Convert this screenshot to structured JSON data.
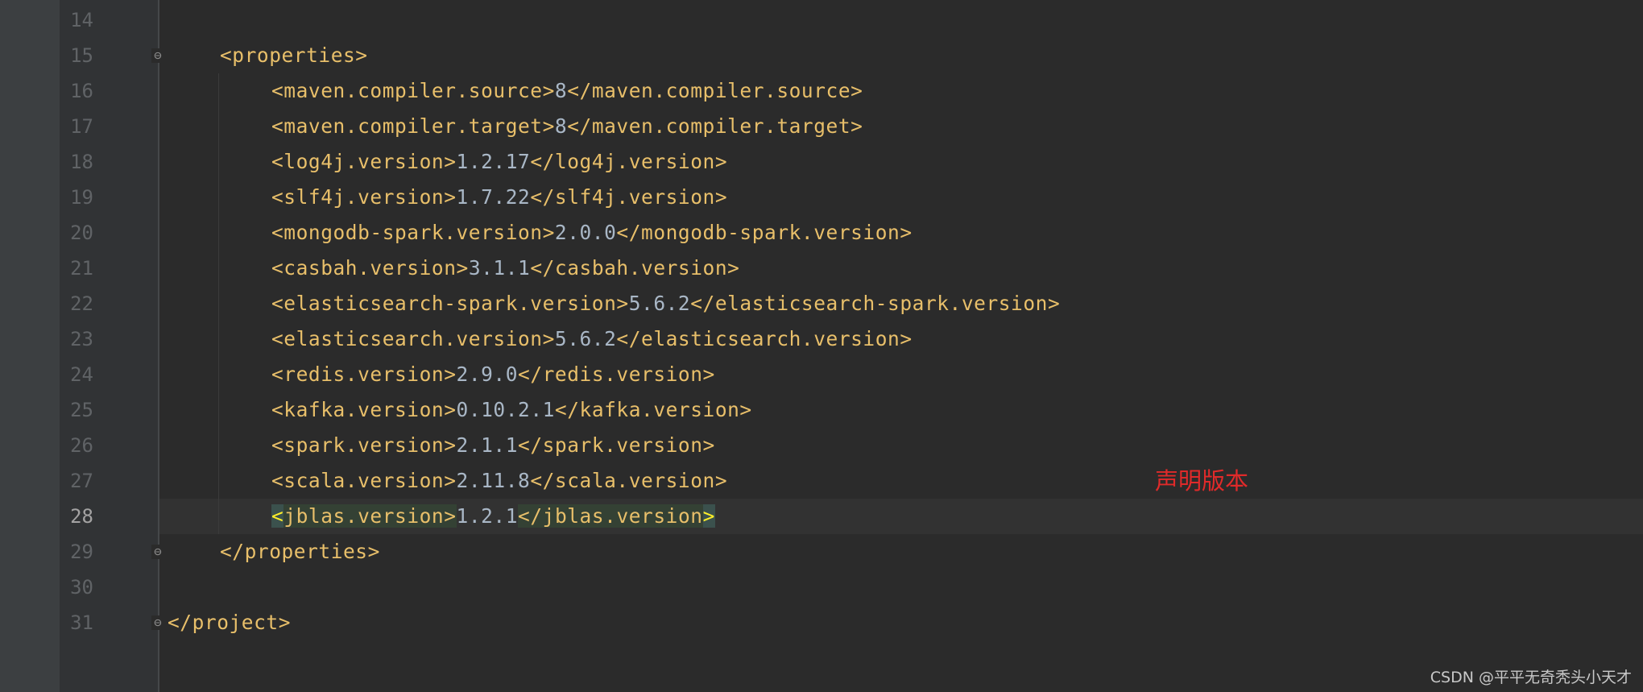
{
  "editor": {
    "lines": [
      {
        "number": "14",
        "parts": []
      },
      {
        "number": "15",
        "fold": "open",
        "parts": [
          {
            "t": "<properties>",
            "c": "tag"
          }
        ]
      },
      {
        "number": "16",
        "parts": [
          {
            "t": "<maven.compiler.source>",
            "c": "tag"
          },
          {
            "t": "8",
            "c": "val"
          },
          {
            "t": "</maven.compiler.source>",
            "c": "tag"
          }
        ]
      },
      {
        "number": "17",
        "parts": [
          {
            "t": "<maven.compiler.target>",
            "c": "tag"
          },
          {
            "t": "8",
            "c": "val"
          },
          {
            "t": "</maven.compiler.target>",
            "c": "tag"
          }
        ]
      },
      {
        "number": "18",
        "parts": [
          {
            "t": "<log4j.version>",
            "c": "tag"
          },
          {
            "t": "1.2.17",
            "c": "val"
          },
          {
            "t": "</log4j.version>",
            "c": "tag"
          }
        ]
      },
      {
        "number": "19",
        "parts": [
          {
            "t": "<slf4j.version>",
            "c": "tag"
          },
          {
            "t": "1.7.22",
            "c": "val"
          },
          {
            "t": "</slf4j.version>",
            "c": "tag"
          }
        ]
      },
      {
        "number": "20",
        "parts": [
          {
            "t": "<mongodb-spark.version>",
            "c": "tag"
          },
          {
            "t": "2.0.0",
            "c": "val"
          },
          {
            "t": "</mongodb-spark.version>",
            "c": "tag"
          }
        ]
      },
      {
        "number": "21",
        "parts": [
          {
            "t": "<casbah.version>",
            "c": "tag"
          },
          {
            "t": "3.1.1",
            "c": "val"
          },
          {
            "t": "</casbah.version>",
            "c": "tag"
          }
        ]
      },
      {
        "number": "22",
        "parts": [
          {
            "t": "<elasticsearch-spark.version>",
            "c": "tag"
          },
          {
            "t": "5.6.2",
            "c": "val"
          },
          {
            "t": "</elasticsearch-spark.version>",
            "c": "tag"
          }
        ]
      },
      {
        "number": "23",
        "parts": [
          {
            "t": "<elasticsearch.version>",
            "c": "tag"
          },
          {
            "t": "5.6.2",
            "c": "val"
          },
          {
            "t": "</elasticsearch.version>",
            "c": "tag"
          }
        ]
      },
      {
        "number": "24",
        "parts": [
          {
            "t": "<redis.version>",
            "c": "tag"
          },
          {
            "t": "2.9.0",
            "c": "val"
          },
          {
            "t": "</redis.version>",
            "c": "tag"
          }
        ]
      },
      {
        "number": "25",
        "parts": [
          {
            "t": "<kafka.version>",
            "c": "tag"
          },
          {
            "t": "0.10.2.1",
            "c": "val"
          },
          {
            "t": "</kafka.version>",
            "c": "tag"
          }
        ]
      },
      {
        "number": "26",
        "parts": [
          {
            "t": "<spark.version>",
            "c": "tag"
          },
          {
            "t": "2.1.1",
            "c": "val"
          },
          {
            "t": "</spark.version>",
            "c": "tag"
          }
        ]
      },
      {
        "number": "27",
        "parts": [
          {
            "t": "<scala.version>",
            "c": "tag"
          },
          {
            "t": "2.11.8",
            "c": "val"
          },
          {
            "t": "</scala.version>",
            "c": "tag"
          }
        ]
      },
      {
        "number": "28",
        "current": true,
        "parts": [
          {
            "t": "<",
            "c": "tag brk-match"
          },
          {
            "t": "jblas.version>",
            "c": "tag tag-match"
          },
          {
            "t": "1.2.1",
            "c": "val"
          },
          {
            "t": "</jblas.version",
            "c": "tag tag-match"
          },
          {
            "t": ">",
            "c": "tag brk-match"
          }
        ]
      },
      {
        "number": "29",
        "fold": "close",
        "parts": [
          {
            "t": "</properties>",
            "c": "tag"
          }
        ]
      },
      {
        "number": "30",
        "parts": []
      },
      {
        "number": "31",
        "fold": "close",
        "parts": [
          {
            "t": "</project>",
            "c": "tag"
          }
        ]
      }
    ]
  },
  "annotation": "声明版本",
  "watermark": "CSDN @平平无奇秃头小天才",
  "colors": {
    "background": "#2b2b2b",
    "tag": "#e8bf6a",
    "value": "#a9b7c6",
    "line_number": "#606366",
    "annotation": "#e02a2a"
  }
}
